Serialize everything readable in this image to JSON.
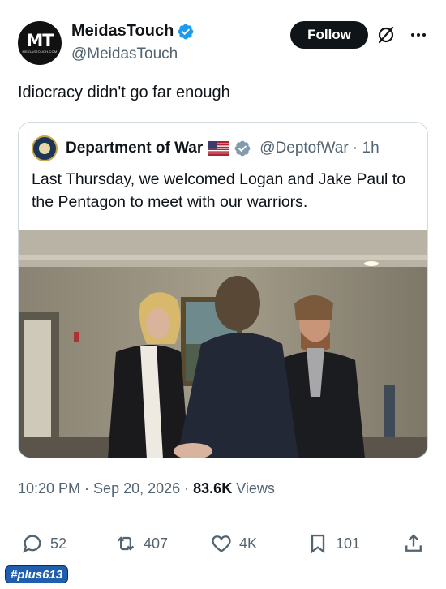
{
  "author": {
    "avatar_text": "MT",
    "avatar_subtext": "MEIDASTOUCH.COM",
    "name": "MeidasTouch",
    "handle": "@MeidasTouch"
  },
  "header": {
    "follow_label": "Follow"
  },
  "tweet": {
    "text": "Idiocracy didn't go far enough"
  },
  "quote": {
    "name": "Department of War",
    "handle": "@DeptofWar · 1h",
    "text": "Last Thursday, we welcomed Logan and Jake Paul to the Pentagon to meet with our warriors."
  },
  "meta": {
    "time": "10:20 PM",
    "sep1": " · ",
    "date": "Sep 20, 2026",
    "sep2": " · ",
    "views_count": "83.6K",
    "views_label": " Views"
  },
  "actions": {
    "reply_count": "52",
    "repost_count": "407",
    "like_count": "4K",
    "bookmark_count": "101"
  },
  "watermark": "#plus613",
  "colors": {
    "verified_blue": "#1d9bf0",
    "text": "#0f1419",
    "muted": "#536471",
    "border": "#cfd9de"
  },
  "icons": [
    "verified-badge-icon",
    "grok-icon",
    "more-icon",
    "us-flag-icon",
    "gray-check-icon",
    "reply-icon",
    "repost-icon",
    "like-icon",
    "bookmark-icon",
    "share-icon"
  ]
}
